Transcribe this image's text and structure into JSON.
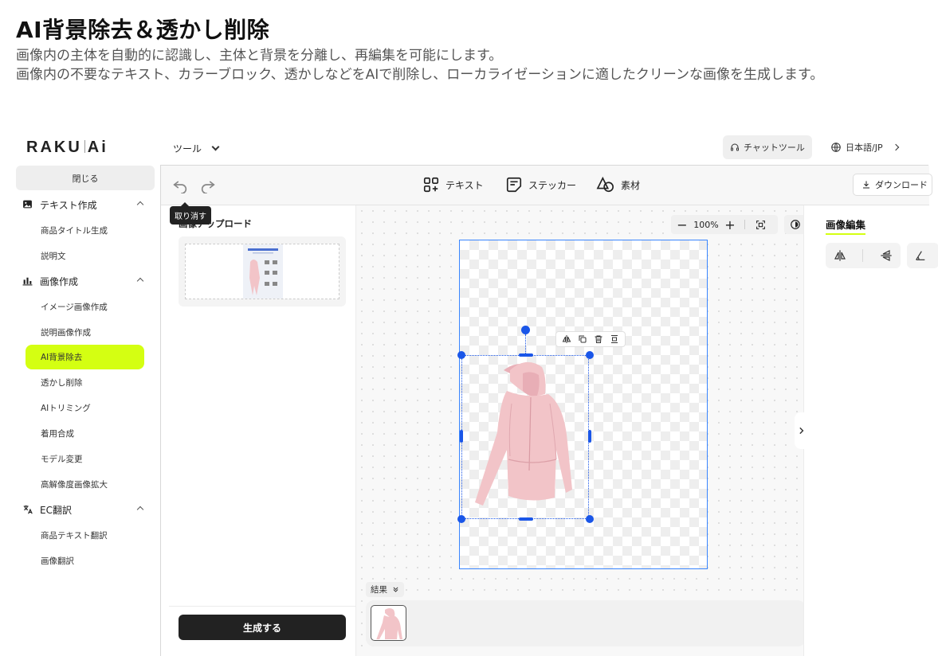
{
  "hero": {
    "title": "AI背景除去＆透かし削除",
    "desc_line1": "画像内の主体を自動的に認識し、主体と背景を分離し、再編集を可能にします。",
    "desc_line2": "画像内の不要なテキスト、カラーブロック、透かしなどをAIで削除し、ローカライゼーションに適したクリーンな画像を生成します。"
  },
  "header": {
    "logo_left": "RAKU",
    "logo_right": "Ai",
    "tools_menu": "ツール",
    "chat_tool": "チャットツール",
    "language": "日本語/JP"
  },
  "sidebar": {
    "close": "閉じる",
    "groups": [
      {
        "label": "テキスト作成",
        "icon": "image-text-icon",
        "items": [
          "商品タイトル生成",
          "説明文"
        ]
      },
      {
        "label": "画像作成",
        "icon": "bar-chart-icon",
        "items": [
          "イメージ画像作成",
          "説明画像作成",
          "AI背景除去",
          "透かし削除",
          "AIトリミング",
          "着用合成",
          "モデル変更",
          "高解像度画像拡大"
        ]
      },
      {
        "label": "EC翻訳",
        "icon": "translate-icon",
        "items": [
          "商品テキスト翻訳",
          "画像翻訳"
        ]
      }
    ],
    "active_item": "AI背景除去"
  },
  "toolbar": {
    "undo_tooltip": "取り消す",
    "text_tool": "テキスト",
    "sticker_tool": "ステッカー",
    "material_tool": "素材",
    "download": "ダウンロード"
  },
  "upload": {
    "title": "画像アップロード",
    "generate": "生成する"
  },
  "canvas": {
    "zoom": "100%",
    "results_label": "結果"
  },
  "right_panel": {
    "title": "画像編集"
  },
  "colors": {
    "accent": "#d4ff12",
    "selection": "#1a56e8",
    "artboard_border": "#3a86ff",
    "garment": "#f2c4c8"
  }
}
